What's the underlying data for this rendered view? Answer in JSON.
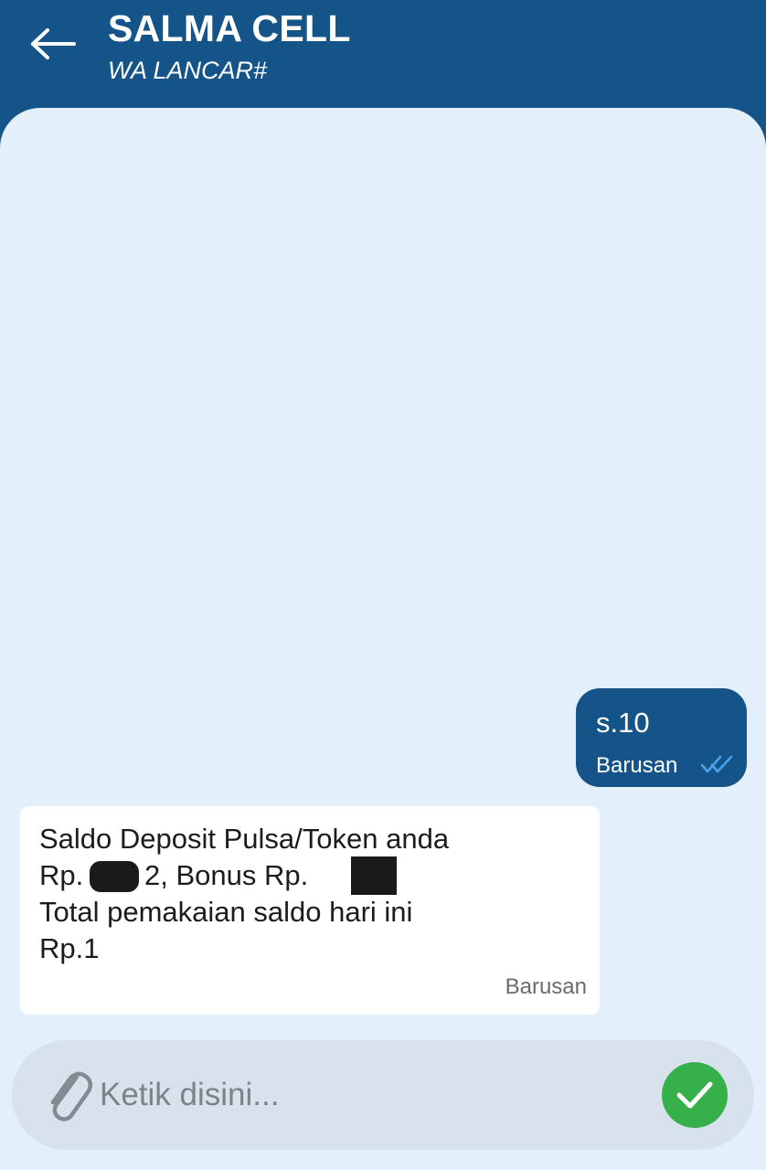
{
  "header": {
    "title": "SALMA CELL",
    "subtitle": "WA LANCAR#",
    "back_icon": "arrow-left-icon"
  },
  "messages": [
    {
      "direction": "outgoing",
      "text": "s.10",
      "time": "Barusan",
      "status_icon": "double-check-icon"
    },
    {
      "direction": "incoming",
      "lines": [
        "Saldo Deposit Pulsa/Token anda",
        "Rp.",
        "2, Bonus Rp.",
        "Total pemakaian saldo hari ini",
        "Rp.1"
      ],
      "time": "Barusan"
    }
  ],
  "composer": {
    "placeholder": "Ketik disini...",
    "attach_icon": "paperclip-icon",
    "send_icon": "checkmark-icon"
  },
  "colors": {
    "header_bg": "#145489",
    "chat_bg": "#e3f0fc",
    "outgoing_bubble": "#145489",
    "incoming_bubble": "#ffffff",
    "send_button": "#36b04a"
  }
}
